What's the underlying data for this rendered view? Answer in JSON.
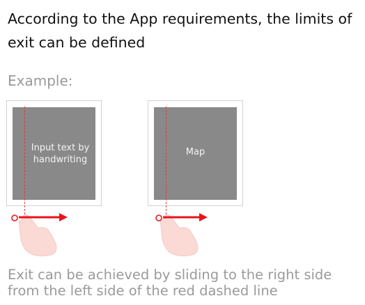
{
  "intro": {
    "text": "According to the App requirements, the limits of exit can be defined"
  },
  "example": {
    "label": "Example:"
  },
  "panels": [
    {
      "screen_text": "Input text by handwriting"
    },
    {
      "screen_text": "Map"
    }
  ],
  "caption": {
    "text": "Exit can be achieved by sliding to the right side from the left side of the red dashed line"
  },
  "colors": {
    "dashed_line": "#e0383c",
    "arrow": "#e8141c",
    "screen": "#898989",
    "hand": "#fbdad6"
  },
  "icons": {
    "touch_point": "touch-point-icon",
    "arrow": "right-arrow-icon",
    "hand": "hand-swipe-icon"
  }
}
